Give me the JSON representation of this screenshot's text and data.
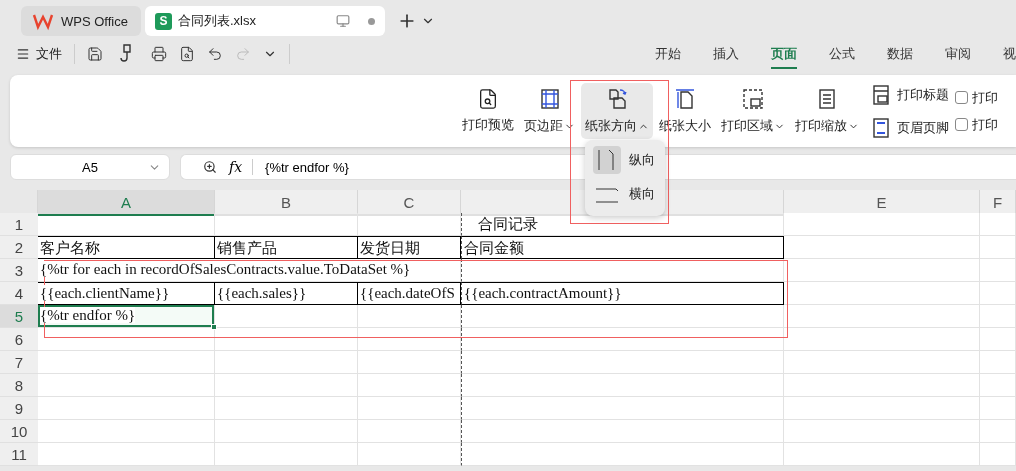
{
  "tabs": [
    {
      "label": "WPS Office",
      "kind": "app",
      "selected": false
    },
    {
      "label": "合同列表.xlsx",
      "kind": "document",
      "selected": true,
      "badge": "S"
    }
  ],
  "file_menu": "文件",
  "menu_tabs": [
    {
      "label": "开始",
      "selected": false
    },
    {
      "label": "插入",
      "selected": false
    },
    {
      "label": "页面",
      "selected": true
    },
    {
      "label": "公式",
      "selected": false
    },
    {
      "label": "数据",
      "selected": false
    },
    {
      "label": "审阅",
      "selected": false
    },
    {
      "label": "视",
      "selected": false
    }
  ],
  "ribbon": {
    "buttons": [
      {
        "label": "打印预览",
        "kind": "plain"
      },
      {
        "label": "页边距",
        "kind": "dropdown",
        "expanded": false
      },
      {
        "label": "纸张方向",
        "kind": "dropdown",
        "expanded": true
      },
      {
        "label": "纸张大小",
        "kind": "plain"
      },
      {
        "label": "打印区域",
        "kind": "dropdown",
        "expanded": false
      },
      {
        "label": "打印缩放",
        "kind": "dropdown",
        "expanded": false
      }
    ],
    "small_buttons": [
      {
        "label": "打印标题"
      },
      {
        "label": "页眉页脚"
      }
    ],
    "checkboxes": [
      {
        "label": "打印",
        "checked": false
      },
      {
        "label": "打印",
        "checked": false
      }
    ]
  },
  "orientation_menu": {
    "items": [
      {
        "label": "纵向",
        "selected": true
      },
      {
        "label": "横向",
        "selected": false
      }
    ]
  },
  "name_box": "A5",
  "function_label": "fx",
  "formula": "{%tr endfor %}",
  "columns": [
    {
      "label": "A",
      "selected": true
    },
    {
      "label": "B",
      "selected": false
    },
    {
      "label": "C",
      "selected": false
    },
    {
      "selected": false
    },
    {
      "label": "E",
      "selected": false
    },
    {
      "label": "F",
      "selected": false
    }
  ],
  "rows": [
    {
      "number": "1",
      "selected": false,
      "bordered": false,
      "cells": [
        {
          "selected": false
        },
        {
          "selected": false
        },
        {
          "selected": false
        },
        {
          "selected": false,
          "text": "合同记录"
        }
      ]
    },
    {
      "number": "2",
      "selected": false,
      "bordered": true,
      "cells": [
        {
          "selected": false,
          "text": "客户名称"
        },
        {
          "selected": false,
          "text": "销售产品"
        },
        {
          "selected": false,
          "text": "发货日期"
        },
        {
          "selected": false,
          "text": "合同金额"
        }
      ]
    },
    {
      "number": "3",
      "selected": false,
      "bordered": false,
      "cells": [
        {
          "selected": false,
          "text": "{%tr for each in recordOfSalesContracts.value.ToDataSet %}"
        },
        {
          "selected": false
        },
        {
          "selected": false
        },
        {
          "selected": false
        }
      ]
    },
    {
      "number": "4",
      "selected": false,
      "bordered": true,
      "cells": [
        {
          "selected": false,
          "text": "{{each.clientName}}"
        },
        {
          "selected": false,
          "text": "{{each.sales}}"
        },
        {
          "selected": false,
          "text": "{{each.dateOfS"
        },
        {
          "selected": false,
          "text": "{{each.contractAmount}}"
        }
      ]
    },
    {
      "number": "5",
      "selected": true,
      "bordered": false,
      "cells": [
        {
          "selected": true,
          "text": "{%tr endfor %}"
        },
        {
          "selected": false
        },
        {
          "selected": false
        },
        {
          "selected": false
        }
      ]
    },
    {
      "number": "6",
      "selected": false,
      "bordered": false
    },
    {
      "number": "7",
      "selected": false,
      "bordered": false
    },
    {
      "number": "8",
      "selected": false,
      "bordered": false
    },
    {
      "number": "9",
      "selected": false,
      "bordered": false
    },
    {
      "number": "10",
      "selected": false,
      "bordered": false
    },
    {
      "number": "11",
      "selected": false,
      "bordered": false
    }
  ]
}
